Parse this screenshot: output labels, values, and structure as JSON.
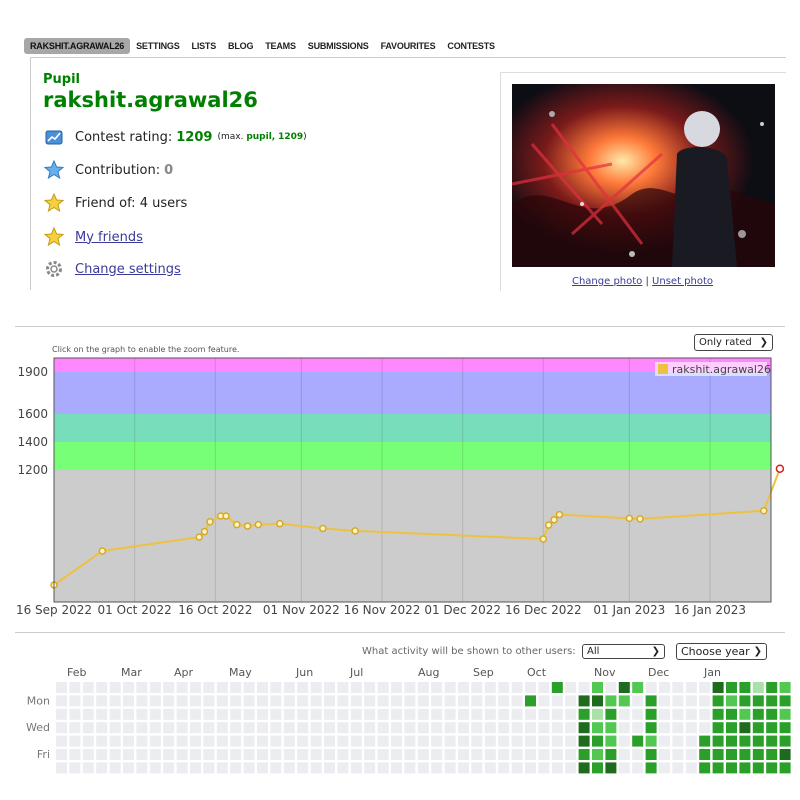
{
  "nav": {
    "items": [
      {
        "label": "RAKSHIT.AGRAWAL26",
        "active": true
      },
      {
        "label": "SETTINGS"
      },
      {
        "label": "LISTS"
      },
      {
        "label": "BLOG"
      },
      {
        "label": "TEAMS"
      },
      {
        "label": "SUBMISSIONS"
      },
      {
        "label": "FAVOURITES"
      },
      {
        "label": "CONTESTS"
      }
    ]
  },
  "profile": {
    "rank": "Pupil",
    "handle": "rakshit.agrawal26",
    "rating_label": "Contest rating:",
    "rating": "1209",
    "max_prefix": "(max.",
    "max_rank": "pupil,",
    "max_rating": "1209",
    "max_suffix": ")",
    "contribution_label": "Contribution:",
    "contribution": "0",
    "friend_of": "Friend of: 4 users",
    "my_friends": "My friends",
    "change_settings": "Change settings",
    "change_photo": "Change photo",
    "photo_sep": "|",
    "unset_photo": "Unset photo"
  },
  "chart_controls": {
    "hint": "Click on the graph to enable the zoom feature.",
    "filter": "Only rated"
  },
  "chart_data": {
    "type": "line",
    "series": [
      {
        "name": "rakshit.agrawal26",
        "color": "#edc240",
        "x": [
          "2022-09-16",
          "2022-09-25",
          "2022-10-13",
          "2022-10-14",
          "2022-10-15",
          "2022-10-17",
          "2022-10-18",
          "2022-10-20",
          "2022-10-22",
          "2022-10-24",
          "2022-10-28",
          "2022-11-05",
          "2022-11-11",
          "2022-12-16",
          "2022-12-17",
          "2022-12-18",
          "2022-12-19",
          "2023-01-01",
          "2023-01-03",
          "2023-01-26",
          "2023-01-29"
        ],
        "y": [
          0,
          355,
          500,
          557,
          660,
          720,
          720,
          630,
          615,
          630,
          640,
          590,
          565,
          480,
          625,
          680,
          735,
          695,
          690,
          775,
          1209
        ]
      }
    ],
    "y_ticks": [
      1200,
      1400,
      1600,
      1900
    ],
    "x_ticks": [
      "16 Sep 2022",
      "01 Oct 2022",
      "16 Oct 2022",
      "01 Nov 2022",
      "16 Nov 2022",
      "01 Dec 2022",
      "16 Dec 2022",
      "01 Jan 2023",
      "16 Jan 2023"
    ],
    "bands": [
      {
        "from": 1200,
        "to": 1400,
        "color": "#77ff77"
      },
      {
        "from": 1400,
        "to": 1600,
        "color": "#77ddbb"
      },
      {
        "from": 1600,
        "to": 1900,
        "color": "#aaaaff"
      },
      {
        "from": 1900,
        "to": 2000,
        "color": "#ff88ff"
      }
    ],
    "legend_position": "top-right",
    "grid": true
  },
  "activity": {
    "label": "What activity will be shown to other users:",
    "filter": "All",
    "year": "Choose year",
    "months": [
      "Feb",
      "Mar",
      "Apr",
      "May",
      "Jun",
      "Jul",
      "Aug",
      "Sep",
      "Oct",
      "Nov",
      "Dec",
      "Jan"
    ],
    "days": [
      "Mon",
      "Wed",
      "Fri"
    ],
    "palette": [
      "#ebedf0",
      "#a9e1a9",
      "#52c752",
      "#2aa02a",
      "#1e6b1e"
    ],
    "weeks": [
      [
        0,
        0,
        0,
        0,
        0,
        0,
        0
      ],
      [
        0,
        0,
        0,
        0,
        0,
        0,
        0
      ],
      [
        0,
        0,
        0,
        0,
        0,
        0,
        0
      ],
      [
        0,
        0,
        0,
        0,
        0,
        0,
        0
      ],
      [
        0,
        0,
        0,
        0,
        0,
        0,
        0
      ],
      [
        0,
        0,
        0,
        0,
        0,
        0,
        0
      ],
      [
        0,
        0,
        0,
        0,
        0,
        0,
        0
      ],
      [
        0,
        0,
        0,
        0,
        0,
        0,
        0
      ],
      [
        0,
        0,
        0,
        0,
        0,
        0,
        0
      ],
      [
        0,
        0,
        0,
        0,
        0,
        0,
        0
      ],
      [
        0,
        0,
        0,
        0,
        0,
        0,
        0
      ],
      [
        0,
        0,
        0,
        0,
        0,
        0,
        0
      ],
      [
        0,
        0,
        0,
        0,
        0,
        0,
        0
      ],
      [
        0,
        0,
        0,
        0,
        0,
        0,
        0
      ],
      [
        0,
        0,
        0,
        0,
        0,
        0,
        0
      ],
      [
        0,
        0,
        0,
        0,
        0,
        0,
        0
      ],
      [
        0,
        0,
        0,
        0,
        0,
        0,
        0
      ],
      [
        0,
        0,
        0,
        0,
        0,
        0,
        0
      ],
      [
        0,
        0,
        0,
        0,
        0,
        0,
        0
      ],
      [
        0,
        0,
        0,
        0,
        0,
        0,
        0
      ],
      [
        0,
        0,
        0,
        0,
        0,
        0,
        0
      ],
      [
        0,
        0,
        0,
        0,
        0,
        0,
        0
      ],
      [
        0,
        0,
        0,
        0,
        0,
        0,
        0
      ],
      [
        0,
        0,
        0,
        0,
        0,
        0,
        0
      ],
      [
        0,
        0,
        0,
        0,
        0,
        0,
        0
      ],
      [
        0,
        0,
        0,
        0,
        0,
        0,
        0
      ],
      [
        0,
        0,
        0,
        0,
        0,
        0,
        0
      ],
      [
        0,
        0,
        0,
        0,
        0,
        0,
        0
      ],
      [
        0,
        0,
        0,
        0,
        0,
        0,
        0
      ],
      [
        0,
        0,
        0,
        0,
        0,
        0,
        0
      ],
      [
        0,
        0,
        0,
        0,
        0,
        0,
        0
      ],
      [
        0,
        0,
        0,
        0,
        0,
        0,
        0
      ],
      [
        0,
        0,
        0,
        0,
        0,
        0,
        0
      ],
      [
        0,
        0,
        0,
        0,
        0,
        0,
        0
      ],
      [
        0,
        0,
        0,
        0,
        0,
        0,
        0
      ],
      [
        0,
        3,
        0,
        0,
        0,
        0,
        0
      ],
      [
        0,
        0,
        0,
        0,
        0,
        0,
        0
      ],
      [
        3,
        0,
        0,
        0,
        0,
        0,
        0
      ],
      [
        0,
        0,
        0,
        0,
        0,
        0,
        0
      ],
      [
        0,
        4,
        3,
        4,
        4,
        3,
        4
      ],
      [
        2,
        4,
        1,
        2,
        3,
        2,
        3
      ],
      [
        0,
        2,
        3,
        2,
        2,
        3,
        4
      ],
      [
        4,
        2,
        0,
        0,
        0,
        0,
        0
      ],
      [
        2,
        0,
        0,
        0,
        3,
        0,
        0
      ],
      [
        0,
        3,
        3,
        3,
        2,
        3,
        3
      ],
      [
        0,
        0,
        0,
        0,
        0,
        0,
        0
      ],
      [
        0,
        0,
        0,
        0,
        0,
        0,
        0
      ],
      [
        0,
        0,
        0,
        0,
        0,
        0,
        0
      ],
      [
        0,
        0,
        0,
        0,
        3,
        3,
        3
      ],
      [
        4,
        3,
        3,
        3,
        3,
        3,
        3
      ],
      [
        3,
        2,
        3,
        3,
        3,
        3,
        3
      ],
      [
        3,
        3,
        2,
        4,
        3,
        3,
        3
      ],
      [
        1,
        3,
        3,
        3,
        3,
        3,
        3
      ],
      [
        3,
        3,
        3,
        3,
        3,
        3,
        3
      ],
      [
        2,
        3,
        2,
        3,
        3,
        4,
        3
      ]
    ]
  }
}
